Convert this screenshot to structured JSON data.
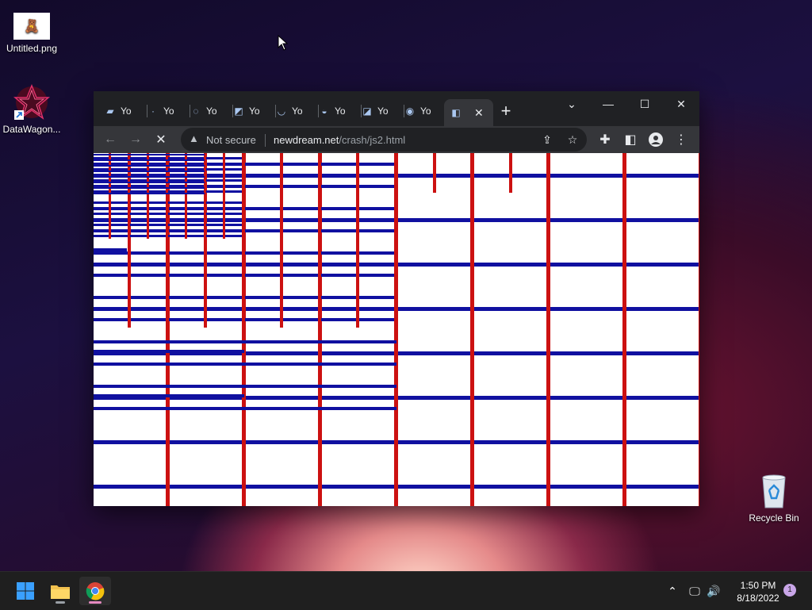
{
  "desktop": {
    "icons": [
      {
        "label": "Untitled.png"
      },
      {
        "label": "DataWagon..."
      },
      {
        "label": "Recycle Bin"
      }
    ]
  },
  "browser": {
    "tabs": [
      {
        "label": "Yo"
      },
      {
        "label": "Yo"
      },
      {
        "label": "Yo"
      },
      {
        "label": "Yo"
      },
      {
        "label": "Yo"
      },
      {
        "label": "Yo"
      },
      {
        "label": "Yo"
      },
      {
        "label": "Yo"
      },
      {
        "label": ""
      }
    ],
    "omnibox": {
      "security_label": "Not secure",
      "url_host": "newdream.net",
      "url_path": "/crash/js2.html"
    }
  },
  "taskbar": {
    "clock_time": "1:50 PM",
    "clock_date": "8/18/2022",
    "notification_count": "1"
  },
  "colors": {
    "line_blue": "#1010a0",
    "line_red": "#cc1111",
    "window_frame": "#202124",
    "toolbar": "#35363a"
  }
}
